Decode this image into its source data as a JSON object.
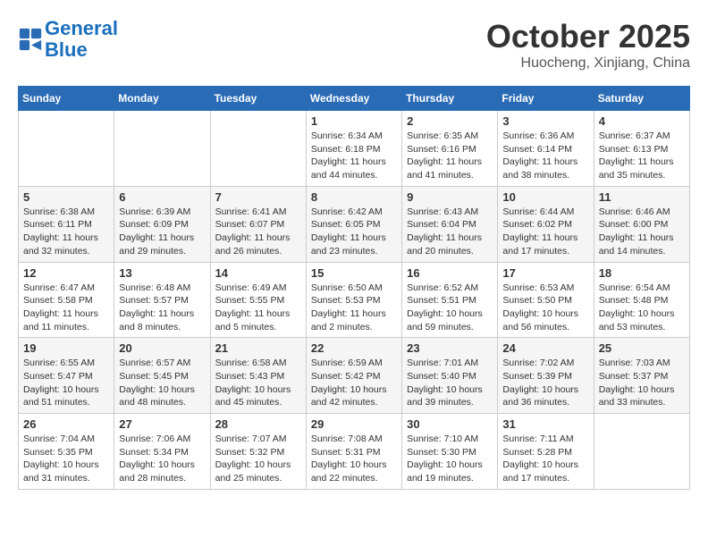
{
  "header": {
    "logo_line1": "General",
    "logo_line2": "Blue",
    "month": "October 2025",
    "location": "Huocheng, Xinjiang, China"
  },
  "weekdays": [
    "Sunday",
    "Monday",
    "Tuesday",
    "Wednesday",
    "Thursday",
    "Friday",
    "Saturday"
  ],
  "weeks": [
    [
      {
        "day": "",
        "info": ""
      },
      {
        "day": "",
        "info": ""
      },
      {
        "day": "",
        "info": ""
      },
      {
        "day": "1",
        "info": "Sunrise: 6:34 AM\nSunset: 6:18 PM\nDaylight: 11 hours and 44 minutes."
      },
      {
        "day": "2",
        "info": "Sunrise: 6:35 AM\nSunset: 6:16 PM\nDaylight: 11 hours and 41 minutes."
      },
      {
        "day": "3",
        "info": "Sunrise: 6:36 AM\nSunset: 6:14 PM\nDaylight: 11 hours and 38 minutes."
      },
      {
        "day": "4",
        "info": "Sunrise: 6:37 AM\nSunset: 6:13 PM\nDaylight: 11 hours and 35 minutes."
      }
    ],
    [
      {
        "day": "5",
        "info": "Sunrise: 6:38 AM\nSunset: 6:11 PM\nDaylight: 11 hours and 32 minutes."
      },
      {
        "day": "6",
        "info": "Sunrise: 6:39 AM\nSunset: 6:09 PM\nDaylight: 11 hours and 29 minutes."
      },
      {
        "day": "7",
        "info": "Sunrise: 6:41 AM\nSunset: 6:07 PM\nDaylight: 11 hours and 26 minutes."
      },
      {
        "day": "8",
        "info": "Sunrise: 6:42 AM\nSunset: 6:05 PM\nDaylight: 11 hours and 23 minutes."
      },
      {
        "day": "9",
        "info": "Sunrise: 6:43 AM\nSunset: 6:04 PM\nDaylight: 11 hours and 20 minutes."
      },
      {
        "day": "10",
        "info": "Sunrise: 6:44 AM\nSunset: 6:02 PM\nDaylight: 11 hours and 17 minutes."
      },
      {
        "day": "11",
        "info": "Sunrise: 6:46 AM\nSunset: 6:00 PM\nDaylight: 11 hours and 14 minutes."
      }
    ],
    [
      {
        "day": "12",
        "info": "Sunrise: 6:47 AM\nSunset: 5:58 PM\nDaylight: 11 hours and 11 minutes."
      },
      {
        "day": "13",
        "info": "Sunrise: 6:48 AM\nSunset: 5:57 PM\nDaylight: 11 hours and 8 minutes."
      },
      {
        "day": "14",
        "info": "Sunrise: 6:49 AM\nSunset: 5:55 PM\nDaylight: 11 hours and 5 minutes."
      },
      {
        "day": "15",
        "info": "Sunrise: 6:50 AM\nSunset: 5:53 PM\nDaylight: 11 hours and 2 minutes."
      },
      {
        "day": "16",
        "info": "Sunrise: 6:52 AM\nSunset: 5:51 PM\nDaylight: 10 hours and 59 minutes."
      },
      {
        "day": "17",
        "info": "Sunrise: 6:53 AM\nSunset: 5:50 PM\nDaylight: 10 hours and 56 minutes."
      },
      {
        "day": "18",
        "info": "Sunrise: 6:54 AM\nSunset: 5:48 PM\nDaylight: 10 hours and 53 minutes."
      }
    ],
    [
      {
        "day": "19",
        "info": "Sunrise: 6:55 AM\nSunset: 5:47 PM\nDaylight: 10 hours and 51 minutes."
      },
      {
        "day": "20",
        "info": "Sunrise: 6:57 AM\nSunset: 5:45 PM\nDaylight: 10 hours and 48 minutes."
      },
      {
        "day": "21",
        "info": "Sunrise: 6:58 AM\nSunset: 5:43 PM\nDaylight: 10 hours and 45 minutes."
      },
      {
        "day": "22",
        "info": "Sunrise: 6:59 AM\nSunset: 5:42 PM\nDaylight: 10 hours and 42 minutes."
      },
      {
        "day": "23",
        "info": "Sunrise: 7:01 AM\nSunset: 5:40 PM\nDaylight: 10 hours and 39 minutes."
      },
      {
        "day": "24",
        "info": "Sunrise: 7:02 AM\nSunset: 5:39 PM\nDaylight: 10 hours and 36 minutes."
      },
      {
        "day": "25",
        "info": "Sunrise: 7:03 AM\nSunset: 5:37 PM\nDaylight: 10 hours and 33 minutes."
      }
    ],
    [
      {
        "day": "26",
        "info": "Sunrise: 7:04 AM\nSunset: 5:35 PM\nDaylight: 10 hours and 31 minutes."
      },
      {
        "day": "27",
        "info": "Sunrise: 7:06 AM\nSunset: 5:34 PM\nDaylight: 10 hours and 28 minutes."
      },
      {
        "day": "28",
        "info": "Sunrise: 7:07 AM\nSunset: 5:32 PM\nDaylight: 10 hours and 25 minutes."
      },
      {
        "day": "29",
        "info": "Sunrise: 7:08 AM\nSunset: 5:31 PM\nDaylight: 10 hours and 22 minutes."
      },
      {
        "day": "30",
        "info": "Sunrise: 7:10 AM\nSunset: 5:30 PM\nDaylight: 10 hours and 19 minutes."
      },
      {
        "day": "31",
        "info": "Sunrise: 7:11 AM\nSunset: 5:28 PM\nDaylight: 10 hours and 17 minutes."
      },
      {
        "day": "",
        "info": ""
      }
    ]
  ]
}
